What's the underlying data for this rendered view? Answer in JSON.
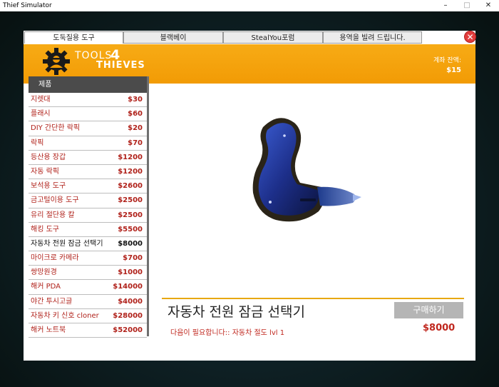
{
  "window": {
    "title": "Thief Simulator",
    "min": "–",
    "max": "□",
    "close": "✕"
  },
  "tabs": [
    {
      "label": "도둑질용 도구"
    },
    {
      "label": "블랙베이"
    },
    {
      "label": "StealYou포럼"
    },
    {
      "label": "용역을 빌려 드립니다."
    }
  ],
  "dialog": {
    "close": "✕"
  },
  "banner": {
    "logo_tools": "TOOLS",
    "logo_four": "4",
    "logo_thieves": "THIEVES",
    "balance_label": "계좌 잔액:",
    "balance_value": "$15"
  },
  "sidebar": {
    "header": "제품",
    "items": [
      {
        "name": "지렛대",
        "price": "$30"
      },
      {
        "name": "플래시",
        "price": "$60"
      },
      {
        "name": "DIY 간단한 락픽",
        "price": "$20"
      },
      {
        "name": "락픽",
        "price": "$70"
      },
      {
        "name": "등산용 장갑",
        "price": "$1200"
      },
      {
        "name": "자동 락픽",
        "price": "$1200"
      },
      {
        "name": "보석용 도구",
        "price": "$2600"
      },
      {
        "name": "금고털이용 도구",
        "price": "$2500"
      },
      {
        "name": "유리 절단용 칼",
        "price": "$2500"
      },
      {
        "name": "해킹 도구",
        "price": "$5500"
      },
      {
        "name": "자동차 전원 잠금 선택기",
        "price": "$8000"
      },
      {
        "name": "마이크로 카메라",
        "price": "$700"
      },
      {
        "name": "쌍망원경",
        "price": "$1000"
      },
      {
        "name": "해커 PDA",
        "price": "$14000"
      },
      {
        "name": "야간 투시고글",
        "price": "$4000"
      },
      {
        "name": "자동차 키 신호 cloner",
        "price": "$28000"
      },
      {
        "name": "해커 노트북",
        "price": "$52000"
      }
    ],
    "selected_index": 10
  },
  "detail": {
    "name": "자동차 전원 잠금 선택기",
    "buy_label": "구매하기",
    "requirement": "다음이 필요합니다:: 자동차 절도 lvl 1",
    "price": "$8000"
  },
  "colors": {
    "accent": "#f29b05",
    "price_red": "#b0211a",
    "header_dark": "#4b4b4b",
    "button_gray": "#b5b5b5"
  }
}
